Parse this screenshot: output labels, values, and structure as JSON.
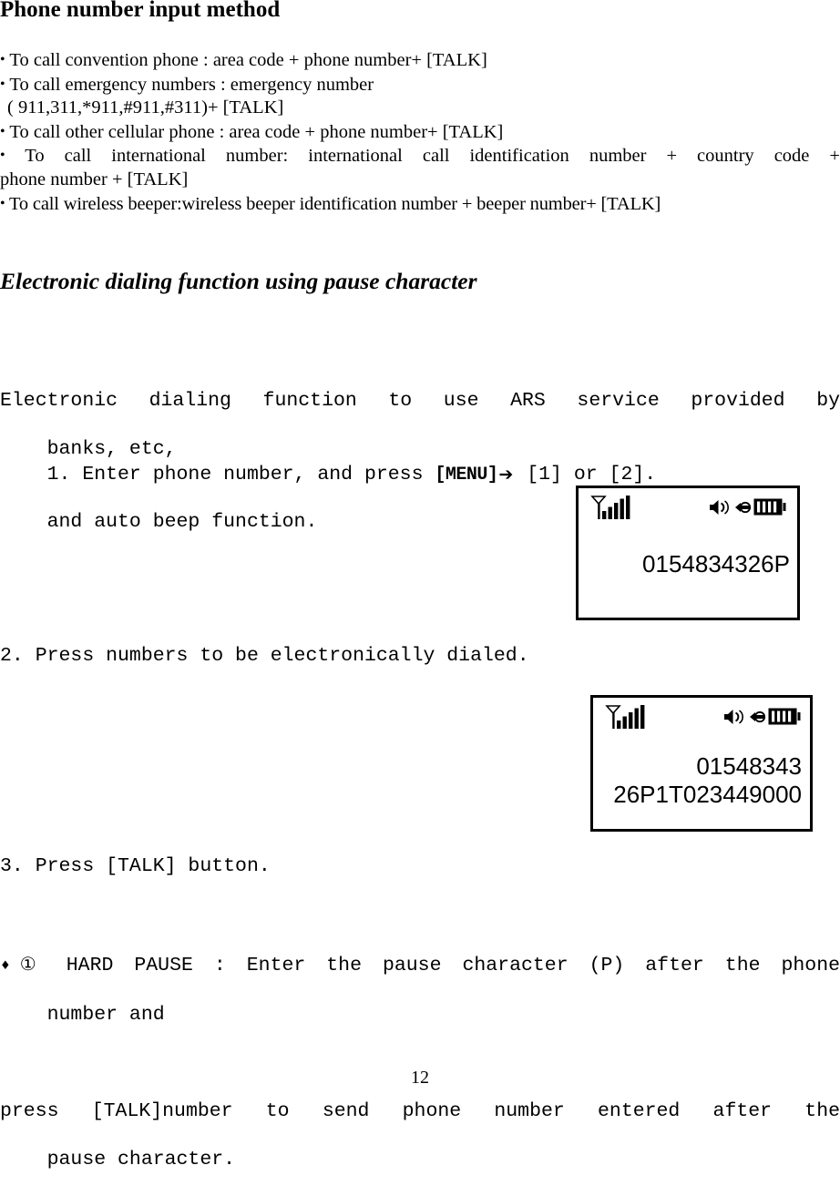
{
  "document": {
    "title": "Phone number input method",
    "section_title": "Electronic dialing function using pause character",
    "page_number": "12"
  },
  "bullets": [
    {
      "marker": "•",
      "text": "To call convention phone : area code + phone number+ [TALK]"
    },
    {
      "marker": "•",
      "text": "To call emergency numbers : emergency number"
    },
    {
      "marker": "",
      "text": "( 911,311,*911,#911,#311)+ [TALK]"
    },
    {
      "marker": "•",
      "text": "To call other cellular phone :  area code + phone number+ [TALK]"
    },
    {
      "marker": "•",
      "text": "To call international number: international call identification number + country code +"
    },
    {
      "marker": "",
      "text": "phone number + [TALK]"
    },
    {
      "marker": "•",
      "text": "To call wireless beeper:wireless beeper identification number + beeper number+ [TALK]"
    }
  ],
  "intro": {
    "line1": "Electronic dialing function to use ARS service provided by",
    "line2": "banks, etc,",
    "line3": "and auto beep function."
  },
  "steps": {
    "step1_prefix": "1. Enter phone number, and press ",
    "step1_key": "[MENU]",
    "step1_arrow": "➔",
    "step1_suffix": " [1] or [2].",
    "step2": "2. Press numbers to be electronically dialed.",
    "step3": "3. Press [TALK] button."
  },
  "note": {
    "bullet": "♦",
    "circled": "①",
    "line1": " HARD PAUSE : Enter the pause character (P) after the phone",
    "line2": "number and",
    "line3": "    press [TALK]number to send phone number entered after the",
    "line4": "pause character."
  },
  "displays": [
    {
      "name": "display-1",
      "status_icons": [
        "signal-icon",
        "speaker-icon",
        "roam-icon",
        "battery-icon"
      ],
      "signal_bars": 5,
      "battery_level": 4,
      "text": "0154834326P"
    },
    {
      "name": "display-2",
      "status_icons": [
        "signal-icon",
        "speaker-icon",
        "roam-icon",
        "battery-icon"
      ],
      "signal_bars": 5,
      "battery_level": 4,
      "text": "01548343\n26P1T023449000"
    }
  ],
  "colors": {
    "text": "#000000",
    "background": "#ffffff",
    "border": "#000000"
  }
}
